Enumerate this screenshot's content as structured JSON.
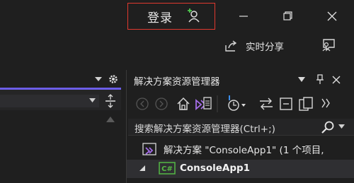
{
  "titlebar": {
    "login_label": "登录",
    "icons": [
      "add-person-icon",
      "minimize-icon",
      "restore-icon",
      "close-icon"
    ]
  },
  "share": {
    "label": "实时分享"
  },
  "solution_explorer": {
    "title": "解决方案资源管理器",
    "search_placeholder": "搜索解决方案资源管理器(Ctrl+;)",
    "tree": [
      {
        "label": "解决方案 \"ConsoleApp1\" (1 个项目,",
        "icon": "solution-icon"
      },
      {
        "label": "ConsoleApp1",
        "icon": "csharp-project-icon",
        "expanded": true
      }
    ]
  },
  "colors": {
    "accent": "#6c5ee8",
    "highlight_border": "#e0392f",
    "background": "#1f1f1f"
  }
}
